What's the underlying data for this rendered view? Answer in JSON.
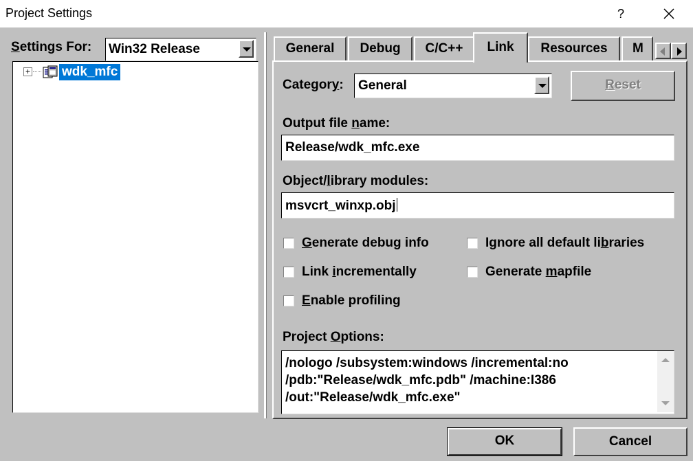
{
  "window": {
    "title": "Project Settings",
    "help_glyph": "?"
  },
  "left_pane": {
    "settings_for": {
      "prefix_u": "S",
      "rest": "ettings For:"
    },
    "config_value": "Win32 Release",
    "tree": {
      "expander": "+",
      "project": "wdk_mfc"
    }
  },
  "tabs": [
    "General",
    "Debug",
    "C/C++",
    "Link",
    "Resources",
    "M"
  ],
  "active_tab": "Link",
  "link": {
    "category": {
      "pre": "Categor",
      "u": "y",
      "post": ":"
    },
    "category_value": "General",
    "reset": {
      "u": "R",
      "post": "eset"
    },
    "output_label": {
      "pre": "Output file ",
      "u": "n",
      "post": "ame:"
    },
    "output_value": "Release/wdk_mfc.exe",
    "objlib_label": {
      "pre": "Object/",
      "u": "l",
      "post": "ibrary modules:"
    },
    "objlib_value": "msvcrt_winxp.obj",
    "checkboxes": {
      "debug": {
        "pre": "",
        "u": "G",
        "post": "enerate debug info"
      },
      "ignore": {
        "pre": "Ignore all default li",
        "u": "b",
        "post": "raries"
      },
      "incremental": {
        "pre": "Link ",
        "u": "i",
        "post": "ncrementally"
      },
      "mapfile": {
        "pre": "Generate ",
        "u": "m",
        "post": "apfile"
      },
      "profiling": {
        "pre": "",
        "u": "E",
        "post": "nable profiling"
      }
    },
    "options_label": {
      "pre": "Project ",
      "u": "O",
      "post": "ptions:"
    },
    "options_value": "/nologo /subsystem:windows /incremental:no\n/pdb:\"Release/wdk_mfc.pdb\" /machine:I386\n/out:\"Release/wdk_mfc.exe\""
  },
  "buttons": {
    "ok": "OK",
    "cancel": "Cancel"
  },
  "colors": {
    "dialog_bg": "#c0c0c0",
    "selection": "#0078d7",
    "titlebar": "#ffffff"
  }
}
